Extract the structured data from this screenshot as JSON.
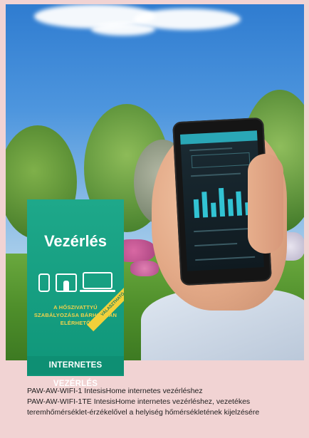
{
  "card": {
    "title": "Vezérlés",
    "description": "A HŐSZIVATTYÚ SZABÁLYOZÁSA BÁRHONNAN ELÉRHETŐ",
    "ribbon": "VÁLASZTHATÓ",
    "banner": "INTERNETES VEZÉRLÉS",
    "devices": [
      "smartphone-icon",
      "tablet-icon",
      "laptop-icon"
    ]
  },
  "captions": [
    "PAW-AW-WIFI-1 IntesisHome internetes vezérléshez",
    "PAW-AW-WIFI-1TE IntesisHome internetes vezérléshez, vezetékes",
    "teremhőmérséklet-érzékelővel a helyiség hőmérsékletének kijelzésére"
  ],
  "colors": {
    "background": "#f1d3d3",
    "card_green": "#1ea88a",
    "accent_yellow": "#f2d03a",
    "screen_accent": "#32c3d3"
  }
}
